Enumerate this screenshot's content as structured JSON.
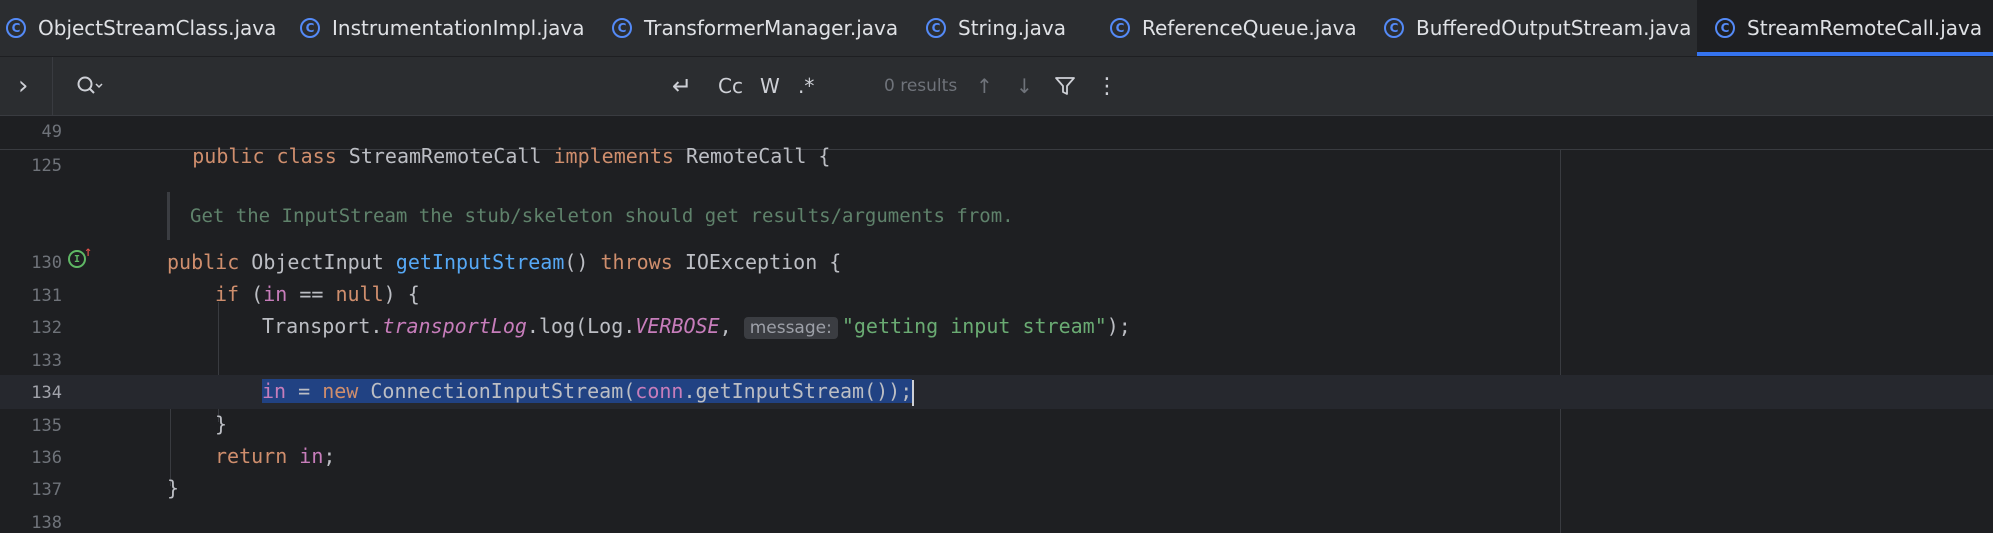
{
  "tabs": [
    {
      "label": "ObjectStreamClass.java",
      "icon": "java-class-icon",
      "active": false
    },
    {
      "label": "InstrumentationImpl.java",
      "icon": "java-class-icon",
      "active": false
    },
    {
      "label": "TransformerManager.java",
      "icon": "java-class-icon",
      "active": false
    },
    {
      "label": "String.java",
      "icon": "java-class-linked-icon",
      "active": false
    },
    {
      "label": "ReferenceQueue.java",
      "icon": "java-class-icon",
      "active": false
    },
    {
      "label": "BufferedOutputStream.java",
      "icon": "java-class-icon",
      "active": false
    },
    {
      "label": "StreamRemoteCall.java",
      "icon": "java-class-icon",
      "active": true,
      "close": "×"
    }
  ],
  "findbar": {
    "expand": "›",
    "search_icon": "search-icon",
    "newline_toggle": "↵",
    "match_case": "Cc",
    "whole_words": "W",
    "regex": ".*",
    "results": "0 results",
    "prev": "↑",
    "next": "↓",
    "filter_icon": "filter-icon",
    "more": "⋮"
  },
  "editor": {
    "sticky_line": {
      "number": "49",
      "text": "public class StreamRemoteCall implements RemoteCall {"
    },
    "doc_comment": "Get the InputStream the stub/skeleton should get results/arguments from.",
    "hint_label": "message:",
    "lines": [
      {
        "number": "125"
      },
      {
        "number": "130",
        "gutter_icon": "implements-icon"
      },
      {
        "number": "131"
      },
      {
        "number": "132"
      },
      {
        "number": "133"
      },
      {
        "number": "134",
        "current": true
      },
      {
        "number": "135"
      },
      {
        "number": "136"
      },
      {
        "number": "137"
      },
      {
        "number": "138"
      }
    ],
    "code": {
      "l130": {
        "mod": "public",
        "type": "ObjectInput",
        "method": "getInputStream",
        "parens": "()",
        "throws": "throws",
        "exc": "IOException {"
      },
      "l131": {
        "kw": "if",
        "open": " (",
        "var": "in",
        "op": " == ",
        "null": "null",
        "close": ") {"
      },
      "l132": {
        "cls": "Transport.",
        "field": "transportLog",
        "call": ".log(Log.",
        "const": "VERBOSE",
        "comma": ", ",
        "str": "\"getting input stream\"",
        "end": ");"
      },
      "l134": {
        "var": "in",
        "eq": " = ",
        "new": "new",
        "rest1": " ConnectionInputStream(",
        "conn": "conn",
        "rest2": ".getInputStream());"
      },
      "l135": {
        "text": "}"
      },
      "l136": {
        "kw": "return",
        "var": "in",
        "semi": ";"
      },
      "l137": {
        "text": "}"
      }
    }
  },
  "colors": {
    "accent": "#3574f0",
    "keyword": "#cf8e6d",
    "method": "#56a8f5",
    "string": "#6aab73",
    "field": "#c77dbb",
    "selection": "#214283"
  }
}
